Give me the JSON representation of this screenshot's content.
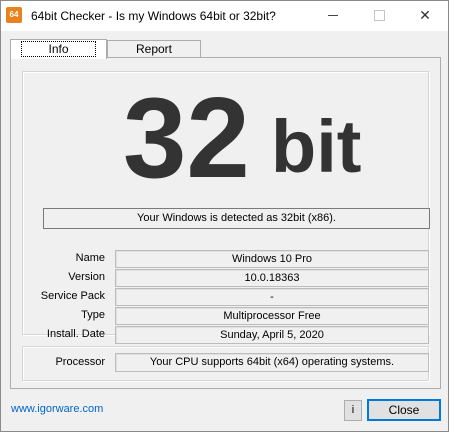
{
  "window": {
    "title": "64bit Checker - Is my Windows 64bit or 32bit?",
    "app_icon_text": "64"
  },
  "tabs": [
    {
      "label": "Info"
    },
    {
      "label": "Report"
    }
  ],
  "result": {
    "number": "32",
    "unit": "bit",
    "detected_text": "Your Windows is detected as 32bit (x86)."
  },
  "details": [
    {
      "label": "Name",
      "value": "Windows 10 Pro"
    },
    {
      "label": "Version",
      "value": "10.0.18363"
    },
    {
      "label": "Service Pack",
      "value": "-"
    },
    {
      "label": "Type",
      "value": "Multiprocessor Free"
    },
    {
      "label": "Install. Date",
      "value": "Sunday, April 5, 2020"
    }
  ],
  "processor": {
    "label": "Processor",
    "value": "Your CPU supports 64bit (x64) operating systems."
  },
  "footer": {
    "website": "www.igorware.com",
    "info_label": "i",
    "close_label": "Close"
  }
}
